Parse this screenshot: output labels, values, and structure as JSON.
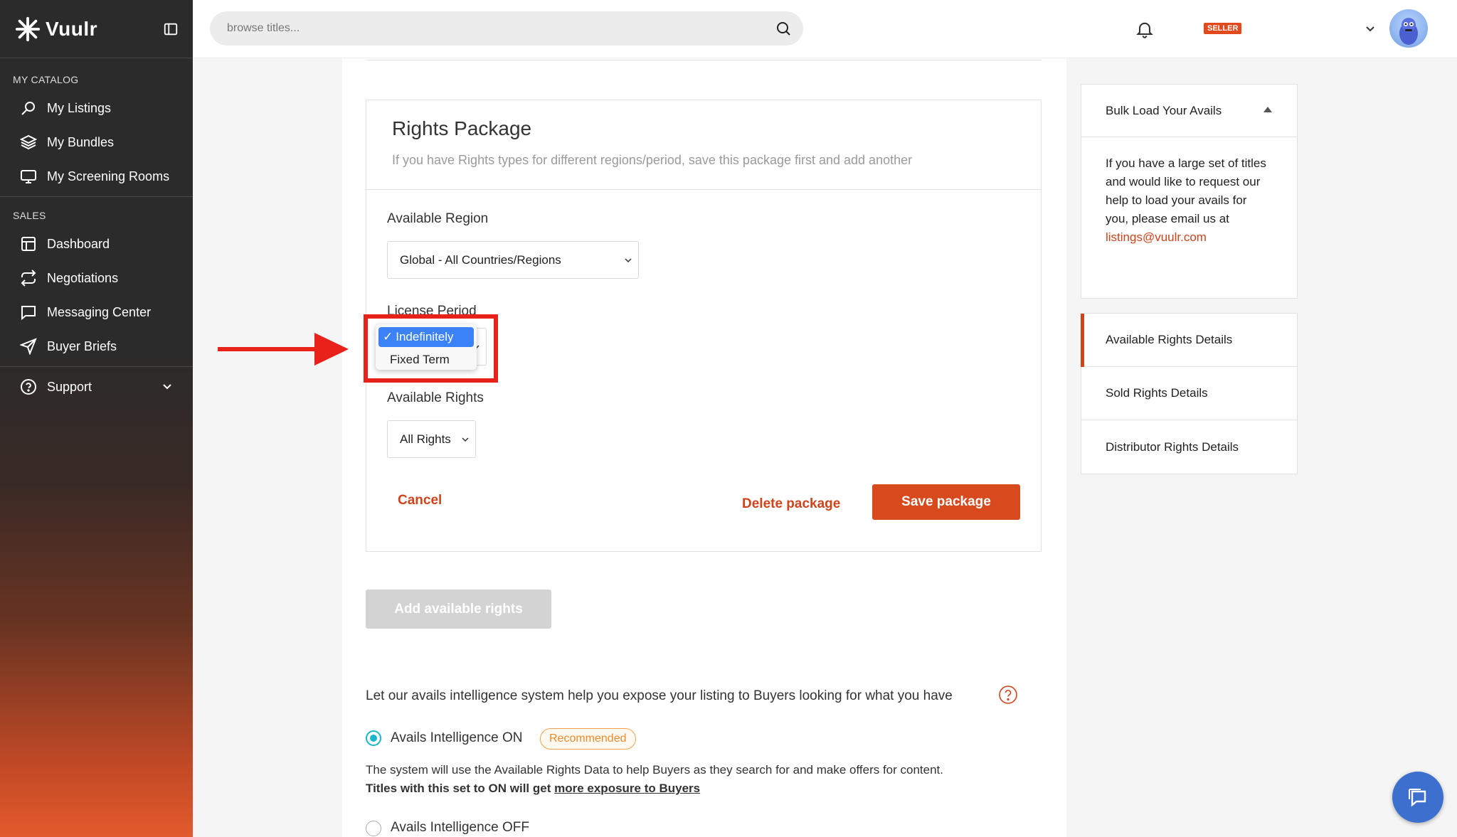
{
  "brand": {
    "name": "Vuulr"
  },
  "sidebar": {
    "sections": [
      {
        "label": "MY CATALOG",
        "items": [
          {
            "label": "My Listings",
            "icon": "search-icon"
          },
          {
            "label": "My Bundles",
            "icon": "layers-icon"
          },
          {
            "label": "My Screening Rooms",
            "icon": "monitor-icon"
          }
        ]
      },
      {
        "label": "SALES",
        "items": [
          {
            "label": "Dashboard",
            "icon": "dashboard-icon"
          },
          {
            "label": "Negotiations",
            "icon": "repeat-icon"
          },
          {
            "label": "Messaging Center",
            "icon": "message-icon"
          },
          {
            "label": "Buyer Briefs",
            "icon": "send-icon"
          }
        ]
      }
    ],
    "support": {
      "label": "Support"
    }
  },
  "header": {
    "search_placeholder": "browse titles...",
    "badge": "SELLER"
  },
  "rights_package": {
    "title": "Rights Package",
    "subtitle": "If you have Rights types for different regions/period, save this package first and add another",
    "region_label": "Available Region",
    "region_value": "Global - All Countries/Regions",
    "license_label": "License Period",
    "license_options": [
      "Indefinitely",
      "Fixed Term"
    ],
    "license_selected_mark": "✓",
    "rights_label": "Available Rights",
    "rights_value": "All Rights",
    "cancel": "Cancel",
    "delete": "Delete package",
    "save": "Save package"
  },
  "add_rights": "Add available rights",
  "avails": {
    "prompt": "Let our avails intelligence system help you expose your listing to Buyers looking for what you have",
    "on_label": "Avails Intelligence ON",
    "recommended": "Recommended",
    "desc": "The system will use the Available Rights Data to help Buyers as they search for and make offers for content.",
    "desc_bold_prefix": "Titles with this set to ON will get ",
    "desc_link": "more exposure to Buyers",
    "off_label": "Avails Intelligence OFF",
    "selected": "on"
  },
  "bulk_panel": {
    "title": "Bulk Load Your Avails",
    "body": "If you have a large set of titles and would like to request our help to load your avails for you, please email us at",
    "email": "listings@vuulr.com"
  },
  "rights_nav": {
    "items": [
      "Available Rights Details",
      "Sold Rights Details",
      "Distributor Rights Details"
    ],
    "active": 0
  },
  "colors": {
    "accent": "#d1431b",
    "radio": "#19b7c9",
    "dropdown_select": "#3b82f6",
    "annotation": "#e8221a"
  }
}
